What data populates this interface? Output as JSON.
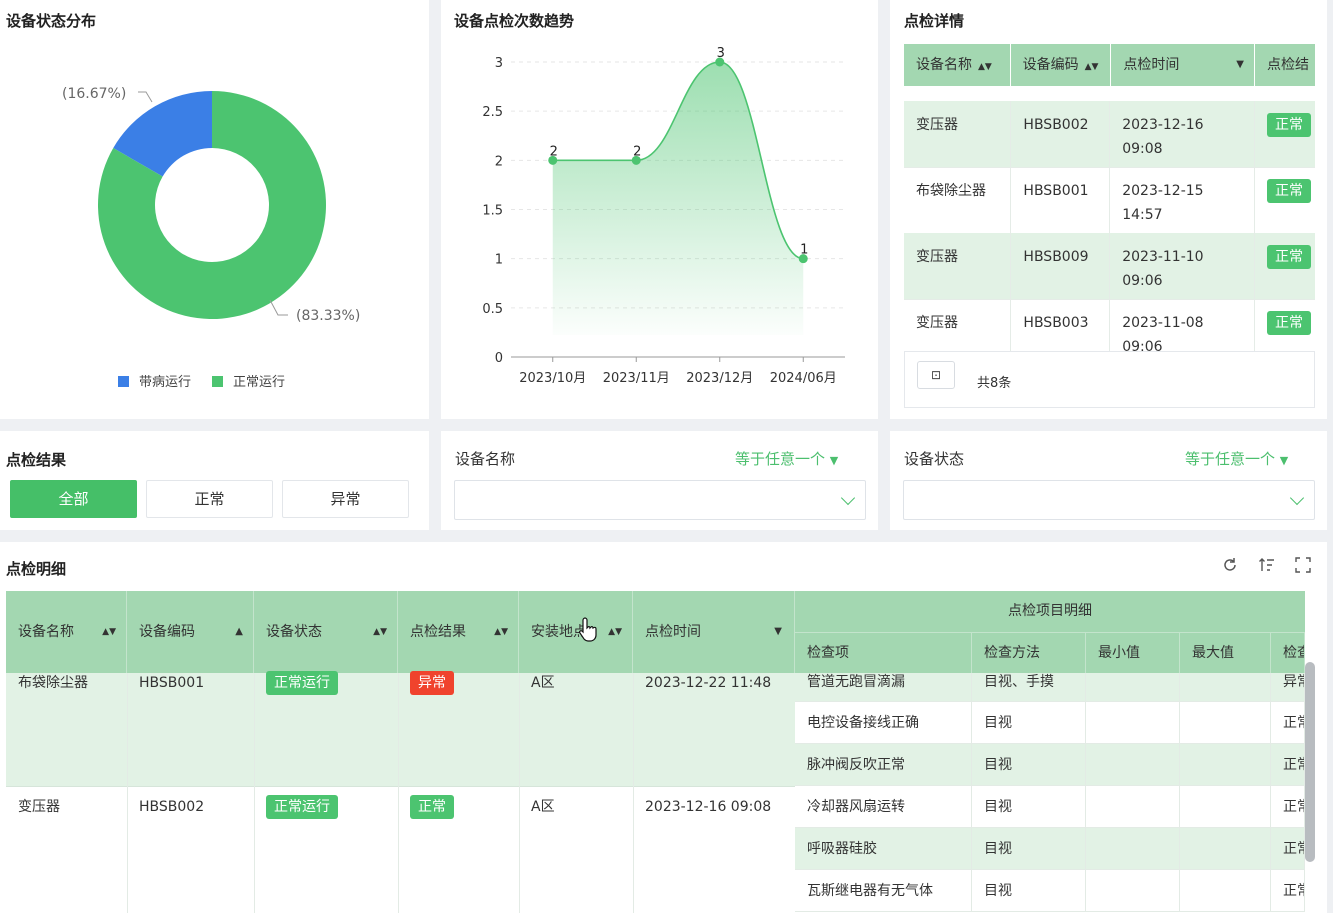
{
  "status_card": {
    "title": "设备状态分布",
    "legend": [
      {
        "label": "带病运行",
        "color": "#3b7fe6"
      },
      {
        "label": "正常运行",
        "color": "#4cc470"
      }
    ],
    "label_sick": "(16.67%)",
    "label_normal": "(83.33%)"
  },
  "trend_card": {
    "title": "设备点检次数趋势"
  },
  "chart_data": [
    {
      "type": "pie",
      "categories": [
        "带病运行",
        "正常运行"
      ],
      "values": [
        16.67,
        83.33
      ],
      "colors": [
        "#3b7fe6",
        "#4cc470"
      ],
      "donut": true,
      "legend": "bottom"
    },
    {
      "type": "area",
      "categories": [
        "2023/10月",
        "2023/11月",
        "2023/12月",
        "2024/06月"
      ],
      "values": [
        2,
        2,
        3,
        1
      ],
      "ylim": [
        0,
        3
      ],
      "yticks": [
        "0",
        "0.5",
        "1",
        "1.5",
        "2",
        "2.5",
        "3"
      ],
      "grid": true,
      "color": "#4cc470"
    }
  ],
  "detail_card": {
    "title": "点检详情",
    "columns": [
      "设备名称",
      "设备编码",
      "点检时间",
      "点检结"
    ],
    "rows": [
      {
        "name": "变压器",
        "code": "HBSB002",
        "date": "2023-12-16",
        "time": "09:08",
        "status": "正常"
      },
      {
        "name": "布袋除尘器",
        "code": "HBSB001",
        "date": "2023-12-15",
        "time": "14:57",
        "status": "正常"
      },
      {
        "name": "变压器",
        "code": "HBSB009",
        "date": "2023-11-10",
        "time": "09:06",
        "status": "正常"
      },
      {
        "name": "变压器",
        "code": "HBSB003",
        "date": "2023-11-08",
        "time": "09:06",
        "status": "正常"
      }
    ],
    "pager_icon": "expand-icon",
    "total": "共8条"
  },
  "result_filter": {
    "title": "点检结果",
    "options": [
      "全部",
      "正常",
      "异常"
    ]
  },
  "name_filter": {
    "label": "设备名称",
    "operator": "等于任意一个"
  },
  "status_filter": {
    "label": "设备状态",
    "operator": "等于任意一个"
  },
  "detail_table": {
    "title": "点检明细",
    "toolbar_icons": [
      "refresh-icon",
      "sort-icon",
      "fullscreen-icon"
    ],
    "columns": [
      "设备名称",
      "设备编码",
      "设备状态",
      "点检结果",
      "安装地点",
      "点检时间"
    ],
    "group_header": "点检项目明细",
    "sub_columns": [
      "检查项",
      "检查方法",
      "最小值",
      "最大值",
      "检查"
    ],
    "rows": [
      {
        "name": "布袋除尘器",
        "code": "HBSB001",
        "status": "正常运行",
        "result": "异常",
        "location": "A区",
        "time": "2023-12-22 11:48",
        "items": [
          {
            "item": "管道无跑冒滴漏",
            "method": "目视、手摸",
            "result": "异常"
          },
          {
            "item": "电控设备接线正确",
            "method": "目视",
            "result": "正常"
          },
          {
            "item": "脉冲阀反吹正常",
            "method": "目视",
            "result": "正常"
          }
        ]
      },
      {
        "name": "变压器",
        "code": "HBSB002",
        "status": "正常运行",
        "result": "正常",
        "location": "A区",
        "time": "2023-12-16 09:08",
        "items": [
          {
            "item": "冷却器风扇运转",
            "method": "目视",
            "result": "正常"
          },
          {
            "item": "呼吸器硅胶",
            "method": "目视",
            "result": "正常"
          },
          {
            "item": "瓦斯继电器有无气体",
            "method": "目视",
            "result": "正常"
          }
        ]
      }
    ]
  }
}
